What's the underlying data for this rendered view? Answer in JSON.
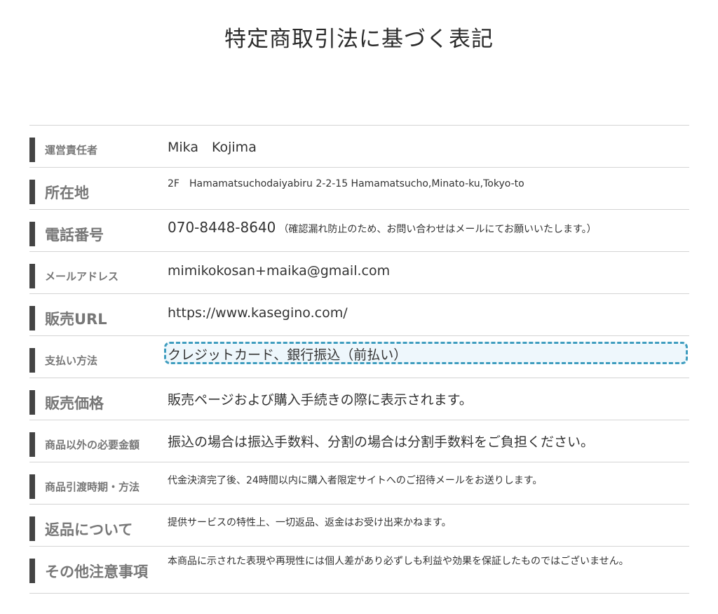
{
  "page": {
    "title": "特定商取引法に基づく表記"
  },
  "rows": [
    {
      "label": "運営責任者",
      "value": "Mika　Kojima"
    },
    {
      "label": "所在地",
      "value": "2F　Hamamatsuchodaiyabiru 2-2-15 Hamamatsucho,Minato-ku,Tokyo-to"
    },
    {
      "label": "電話番号",
      "value": "070-8448-8640",
      "note": "（確認漏れ防止のため、お問い合わせはメールにてお願いいたします。）"
    },
    {
      "label": "メールアドレス",
      "value": "mimikokosan+maika@gmail.com"
    },
    {
      "label": "販売URL",
      "value": "https://www.kasegino.com/"
    },
    {
      "label": "支払い方法",
      "value": "クレジットカード、銀行振込（前払い）"
    },
    {
      "label": "販売価格",
      "value": "販売ページおよび購入手続きの際に表示されます。"
    },
    {
      "label": "商品以外の必要金額",
      "value": "振込の場合は振込手数料、分割の場合は分割手数料をご負担ください。"
    },
    {
      "label": "商品引渡時期・方法",
      "value": "代金決済完了後、24時間以内に購入者限定サイトへのご招待メールをお送りします。"
    },
    {
      "label": "返品について",
      "value": "提供サービスの特性上、一切返品、返金はお受け出来かねます。"
    },
    {
      "label": "その他注意事項",
      "value": "本商品に示された表現や再現性には個人差があり必ずしも利益や効果を保証したものではございません。"
    }
  ],
  "colors": {
    "highlight_border": "#3f9dbf",
    "highlight_fill": "#eef7fc",
    "bar": "#444444"
  }
}
